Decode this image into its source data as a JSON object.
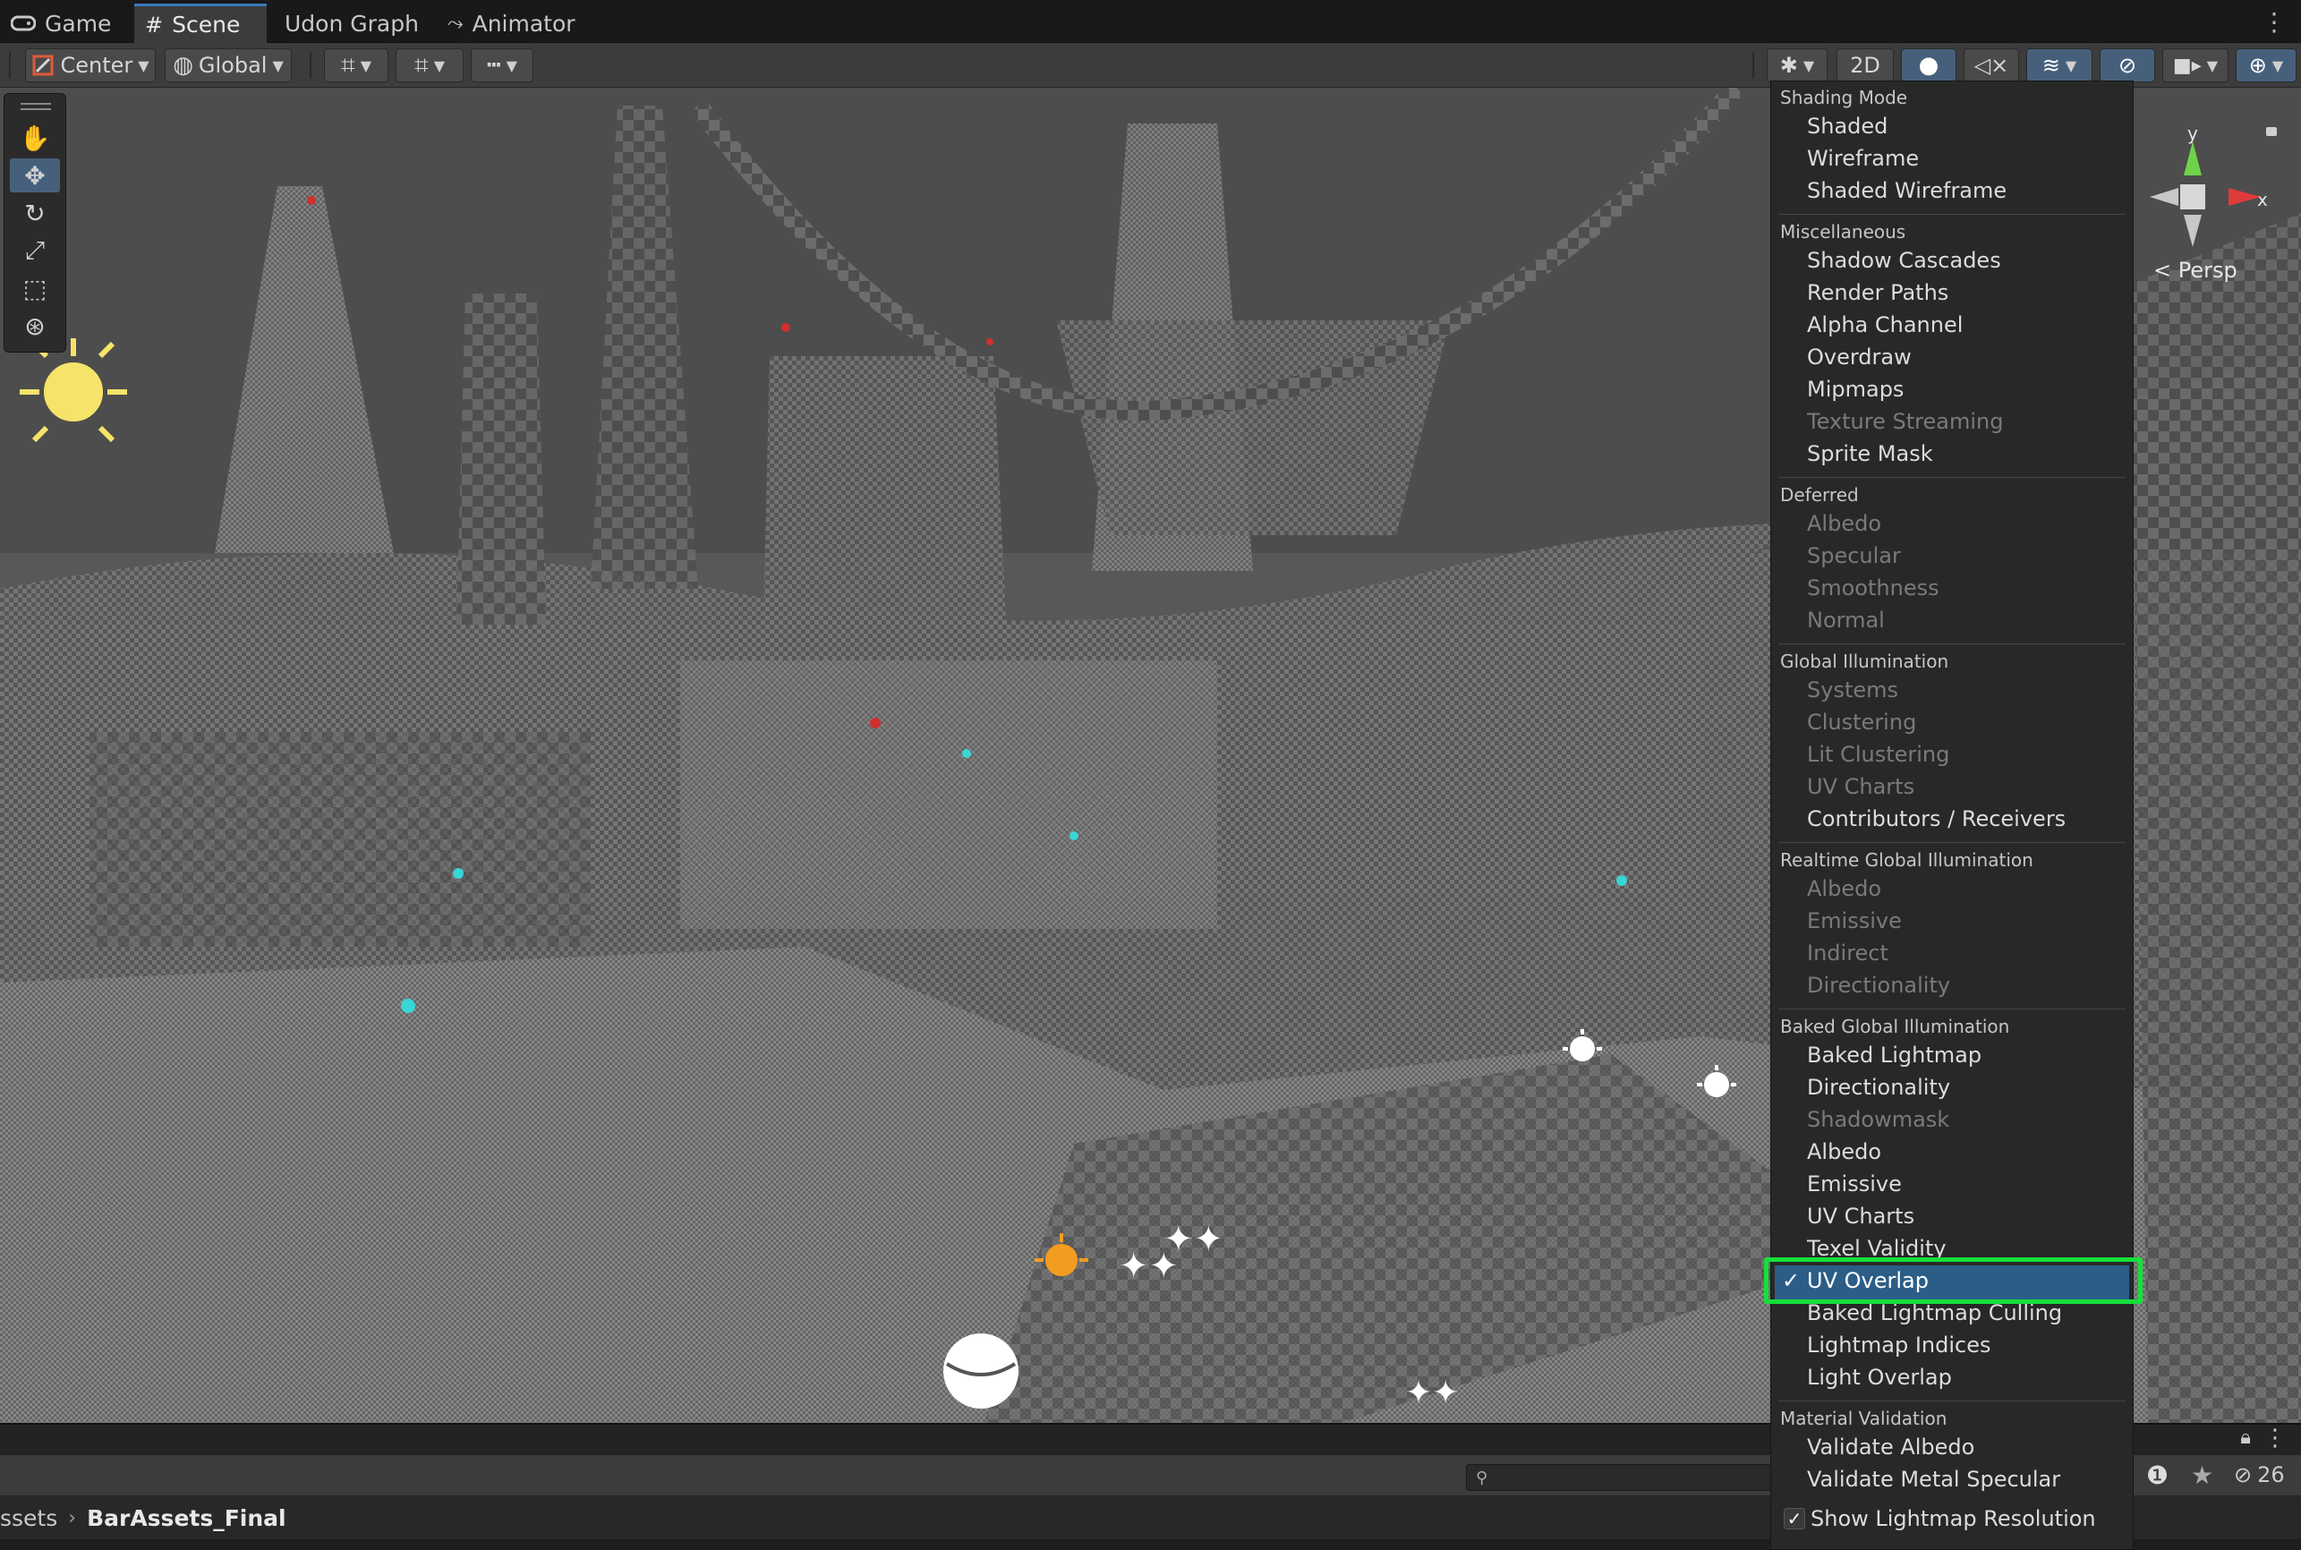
{
  "tabs": [
    {
      "label": "Game",
      "icon": "gamepad-icon"
    },
    {
      "label": "Scene",
      "icon": "grid-icon"
    },
    {
      "label": "Udon Graph",
      "icon": ""
    },
    {
      "label": "Animator",
      "icon": "animator-icon"
    }
  ],
  "toolbar": {
    "pivot_label": "Center",
    "space_label": "Global",
    "mode_2d_label": "2D"
  },
  "gizmo": {
    "y_label": "y",
    "x_label": "x",
    "projection_label": "Persp"
  },
  "menu": {
    "sections": {
      "shading_mode": "Shading Mode",
      "miscellaneous": "Miscellaneous",
      "deferred": "Deferred",
      "global_illumination": "Global Illumination",
      "realtime_gi": "Realtime Global Illumination",
      "baked_gi": "Baked Global Illumination",
      "material_validation": "Material Validation"
    },
    "items": {
      "shaded": "Shaded",
      "wireframe": "Wireframe",
      "shaded_wireframe": "Shaded Wireframe",
      "shadow_cascades": "Shadow Cascades",
      "render_paths": "Render Paths",
      "alpha_channel": "Alpha Channel",
      "overdraw": "Overdraw",
      "mipmaps": "Mipmaps",
      "texture_streaming": "Texture Streaming",
      "sprite_mask": "Sprite Mask",
      "def_albedo": "Albedo",
      "def_specular": "Specular",
      "def_smoothness": "Smoothness",
      "def_normal": "Normal",
      "gi_systems": "Systems",
      "gi_clustering": "Clustering",
      "gi_lit_clustering": "Lit Clustering",
      "gi_uv_charts": "UV Charts",
      "gi_contributors": "Contributors / Receivers",
      "rt_albedo": "Albedo",
      "rt_emissive": "Emissive",
      "rt_indirect": "Indirect",
      "rt_directionality": "Directionality",
      "bk_baked_lightmap": "Baked Lightmap",
      "bk_directionality": "Directionality",
      "bk_shadowmask": "Shadowmask",
      "bk_albedo": "Albedo",
      "bk_emissive": "Emissive",
      "bk_uv_charts": "UV Charts",
      "bk_texel_validity": "Texel Validity",
      "bk_uv_overlap": "UV Overlap",
      "bk_baked_lightmap_culling": "Baked Lightmap Culling",
      "bk_lightmap_indices": "Lightmap Indices",
      "bk_light_overlap": "Light Overlap",
      "mv_validate_albedo": "Validate Albedo",
      "mv_validate_metal_specular": "Validate Metal Specular",
      "show_lightmap_resolution": "Show Lightmap Resolution"
    },
    "checkmark": "✓"
  },
  "project": {
    "breadcrumb_parent": "ssets",
    "breadcrumb_current": "BarAssets_Final",
    "hidden_count": "26"
  }
}
